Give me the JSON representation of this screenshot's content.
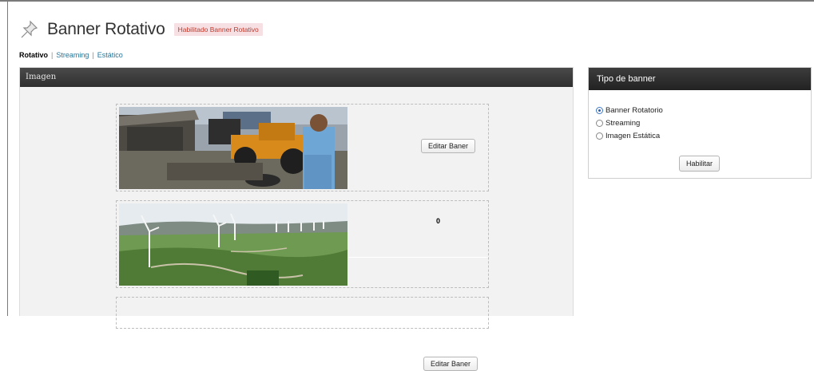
{
  "page": {
    "title": "Banner Rotativo",
    "status_badge": "Habilitado Banner Rotativo"
  },
  "subnav": {
    "current": "Rotativo",
    "separator": "|",
    "links": [
      "Streaming",
      "Estático"
    ]
  },
  "image_panel": {
    "title": "Imagen",
    "rows": [
      {
        "image": "excavator-photo",
        "edit_label": "Editar Baner"
      },
      {
        "image": "wind-turbines-photo",
        "order": "0",
        "edit_label": "Editar Baner"
      }
    ]
  },
  "type_panel": {
    "title": "Tipo de banner",
    "options": [
      {
        "label": "Banner Rotatorio",
        "checked": true
      },
      {
        "label": "Streaming",
        "checked": false
      },
      {
        "label": "Imagen Estática",
        "checked": false
      }
    ],
    "submit_label": "Habilitar"
  },
  "colors": {
    "link": "#21759b",
    "badge_bg": "#f7e0e4",
    "badge_text": "#c0392b",
    "header_dark": "#2f2f2f"
  }
}
